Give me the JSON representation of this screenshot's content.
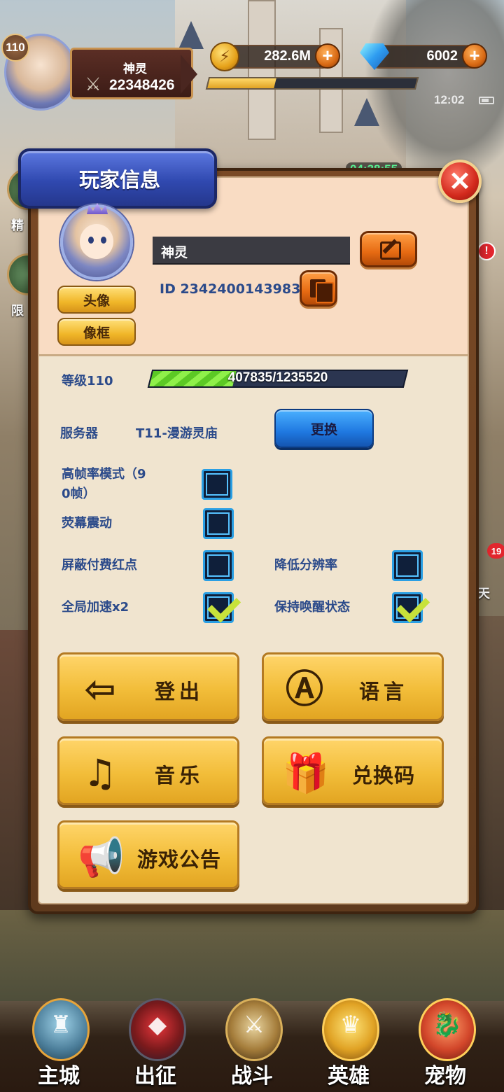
{
  "hud": {
    "player_level": "110",
    "player_name": "神灵",
    "power": "22348426",
    "coins": "282.6M",
    "gems": "6002",
    "exp_fraction": 0.32,
    "clock": "12:02",
    "event_timer": "04:38:55"
  },
  "side": {
    "left_label_1": "精",
    "left_label_2": "限",
    "right_badge_alert": "!",
    "right_badge_count": "19",
    "right_label": "天"
  },
  "modal": {
    "title": "玩家信息",
    "close_glyph": "✕",
    "avatar_button": "头像",
    "frame_button": "像框",
    "name_value": "神灵",
    "player_id": "ID 2342400143983",
    "level_label": "等级110",
    "exp_text": "407835/1235520",
    "exp_fraction": 0.33,
    "server_label": "服务器",
    "server_name": "T11-漫游灵庙",
    "change_button": "更换",
    "options": {
      "high_fps_line1": "高帧率模式（9",
      "high_fps_line2": "0帧）",
      "high_fps_checked": false,
      "screen_shake": "荧幕震动",
      "screen_shake_checked": false,
      "hide_paid_dot": "屏蔽付费红点",
      "hide_paid_dot_checked": false,
      "lower_resolution": "降低分辨率",
      "lower_resolution_checked": false,
      "global_speed": "全局加速x2",
      "global_speed_checked": true,
      "keep_awake": "保持唤醒状态",
      "keep_awake_checked": true
    },
    "actions": {
      "logout": "登出",
      "language": "语言",
      "music": "音乐",
      "redeem": "兑换码",
      "notice": "游戏公告"
    }
  },
  "nav": {
    "city": "主城",
    "expedition": "出征",
    "battle": "战斗",
    "heroes": "英雄",
    "pets": "宠物"
  },
  "colors": {
    "label_blue": "#2b4a8a",
    "panel_bg": "#f0e4cf",
    "title_blue": "#3049b0",
    "button_yellow": "#f2bd39",
    "check_green": "#c7e23a"
  }
}
